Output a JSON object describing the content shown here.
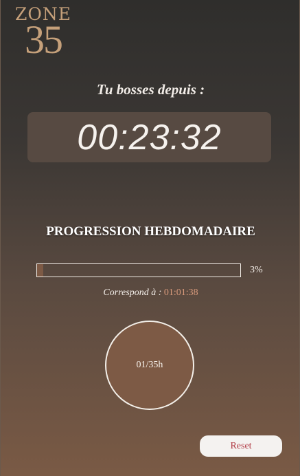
{
  "logo": {
    "top": "ZONE",
    "bottom": "35"
  },
  "timer": {
    "label": "Tu bosses depuis :",
    "value": "00:23:32"
  },
  "weekly": {
    "title": "PROGRESSION HEBDOMADAIRE",
    "progress_percent": 3,
    "progress_label": "3%",
    "correspond_label": "Correspond à :",
    "correspond_value": "01:01:38",
    "hours_display": "01/35h"
  },
  "actions": {
    "reset_label": "Reset"
  },
  "colors": {
    "accent": "#7d5a45",
    "logo": "#c5a07a",
    "time_highlight": "#d89a7b",
    "reset_text": "#b13b45"
  }
}
